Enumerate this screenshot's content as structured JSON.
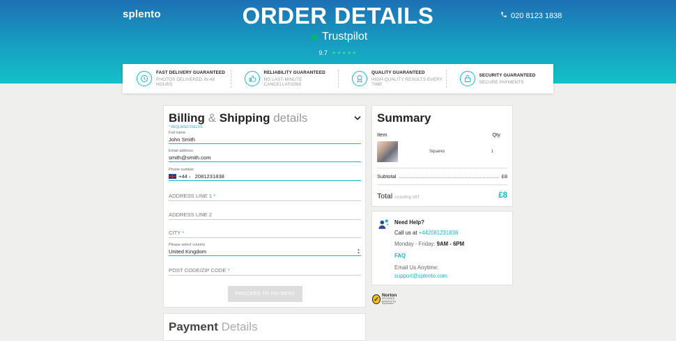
{
  "header": {
    "brand": "splento",
    "title": "ORDER DETAILS",
    "phone": "020 8123 1838",
    "trustpilot_label": "Trustpilot",
    "rating_value": "9.7",
    "rating_stars": "★★★★★"
  },
  "guarantees": [
    {
      "title": "FAST DELIVERY GUARANTEED",
      "subtitle": "PHOTOS DELIVERED IN 48 HOURS",
      "icon": "clock-icon"
    },
    {
      "title": "RELIABILITY GUARANTEED",
      "subtitle": "NO LAST-MINUTE CANCELLATIONS",
      "icon": "thumbs-up-icon"
    },
    {
      "title": "QUALITY GUARANTEED",
      "subtitle": "HIGH-QUALITY RESULTS EVERY TIME",
      "icon": "badge-icon"
    },
    {
      "title": "SECURITY GUARANTEED",
      "subtitle": "SECURE PAYMENTS",
      "icon": "lock-icon"
    }
  ],
  "billing": {
    "title_bold_1": "Billing",
    "title_amp": "&",
    "title_bold_2": "Shipping",
    "title_light": "details",
    "required_note": "* REQUIRED FIELDS",
    "full_name": {
      "label": "Full name",
      "value": "John Smith"
    },
    "email": {
      "label": "Email address",
      "value": "smith@smith.com"
    },
    "phone": {
      "label": "Phone number",
      "code": "+44",
      "value": "2081231838"
    },
    "address1": {
      "placeholder": "ADDRESS LINE 1"
    },
    "address2": {
      "placeholder": "ADDRESS LINE 2"
    },
    "city": {
      "placeholder": "CITY"
    },
    "country": {
      "label": "Please select country",
      "value": "United Kingdom"
    },
    "postcode": {
      "placeholder": "POST CODE/ZIP CODE"
    },
    "required_mark": "*",
    "proceed_label": "PROCEED TO PAYMENT"
  },
  "payment": {
    "title_bold": "Payment",
    "title_light": "Details"
  },
  "summary": {
    "title": "Summary",
    "col_item": "Item",
    "col_qty": "Qty",
    "item_name": "Squares",
    "item_qty": "1",
    "subtotal_label": "Subtotal",
    "subtotal_value": "£8",
    "total_label": "Total",
    "total_note": "including VAT",
    "total_value": "£8"
  },
  "help": {
    "title": "Need Help?",
    "call_prefix": "Call us at",
    "call_number": "+442081231838",
    "hours_prefix": "Monday - Friday:",
    "hours": "9AM - 6PM",
    "faq": "FAQ",
    "email_label": "Email Us Anytime:",
    "email": "support@splento.com"
  },
  "norton": {
    "name": "Norton",
    "secured": "SECURED",
    "powered": "powered by Symantec"
  },
  "colors": {
    "accent": "#14b4c4",
    "header_top": "#1e70b4",
    "header_bottom": "#14c1c9"
  }
}
